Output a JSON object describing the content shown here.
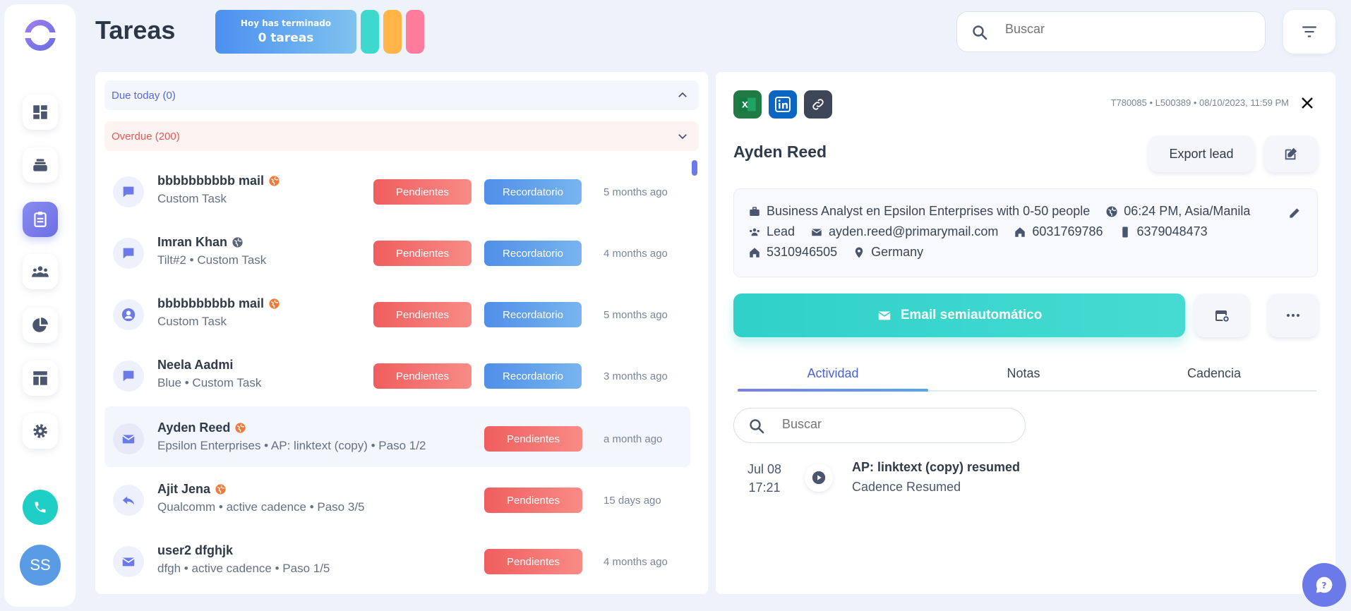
{
  "header": {
    "title": "Tareas",
    "done_card": {
      "line1": "Hoy has terminado",
      "line2": "0 tareas"
    },
    "pill_colors": [
      "#3fd8cf",
      "#ffb547",
      "#ff7c9c"
    ],
    "search_placeholder": "Buscar"
  },
  "sidebar": {
    "items": [
      "dashboard-icon",
      "stack-icon",
      "clipboard-icon",
      "team-icon",
      "pie-chart-icon",
      "layout-icon",
      "gear-icon"
    ],
    "active_index": 2,
    "avatar_initials": "SS"
  },
  "sections": {
    "due": "Due today (0)",
    "overdue": "Overdue (200)"
  },
  "tasks": [
    {
      "icon": "chat-icon",
      "name": "bbbbbbbbbb mail",
      "sub": "Custom Task",
      "status": "Pendientes",
      "reminder": "Recordatorio",
      "time": "5 months ago",
      "flag": "orange"
    },
    {
      "icon": "chat-icon",
      "name": "Imran Khan",
      "sub": "Tilt#2 • Custom Task",
      "status": "Pendientes",
      "reminder": "Recordatorio",
      "time": "4 months ago",
      "flag": "grey"
    },
    {
      "icon": "user-icon",
      "name": "bbbbbbbbbb mail",
      "sub": "Custom Task",
      "status": "Pendientes",
      "reminder": "Recordatorio",
      "time": "5 months ago",
      "flag": "orange"
    },
    {
      "icon": "chat-icon",
      "name": "Neela Aadmi",
      "sub": "Blue • Custom Task",
      "status": "Pendientes",
      "reminder": "Recordatorio",
      "time": "3 months ago",
      "flag": ""
    },
    {
      "icon": "mail-icon",
      "name": "Ayden Reed",
      "sub": "Epsilon Enterprises • AP: linktext (copy) • Paso 1/2",
      "status": "Pendientes",
      "reminder": "",
      "time": "a month ago",
      "flag": "orange",
      "selected": true
    },
    {
      "icon": "reply-icon",
      "name": "Ajit Jena",
      "sub": "Qualcomm • active cadence • Paso 3/5",
      "status": "Pendientes",
      "reminder": "",
      "time": "15 days ago",
      "flag": "orange"
    },
    {
      "icon": "mail-icon",
      "name": "user2 dfghjk",
      "sub": "dfgh • active cadence • Paso 1/5",
      "status": "Pendientes",
      "reminder": "",
      "time": "4 months ago",
      "flag": ""
    }
  ],
  "detail": {
    "meta": "T780085 • L500389 • 08/10/2023, 11:59 PM",
    "name": "Ayden Reed",
    "export_label": "Export lead",
    "info": {
      "job": "Business Analyst en Epsilon Enterprises with 0-50 people",
      "local_time": "06:24 PM, Asia/Manila",
      "type": "Lead",
      "email": "ayden.reed@primarymail.com",
      "phone1": "6031769786",
      "mobile": "6379048473",
      "phone2": "5310946505",
      "country": "Germany"
    },
    "cta_label": "Email semiautomático",
    "tabs": [
      "Actividad",
      "Notas",
      "Cadencia"
    ],
    "activity_search_placeholder": "Buscar",
    "activity": [
      {
        "date": "Jul 08",
        "time": "17:21",
        "title": "AP: linktext (copy) resumed",
        "sub": "Cadence Resumed"
      }
    ]
  }
}
